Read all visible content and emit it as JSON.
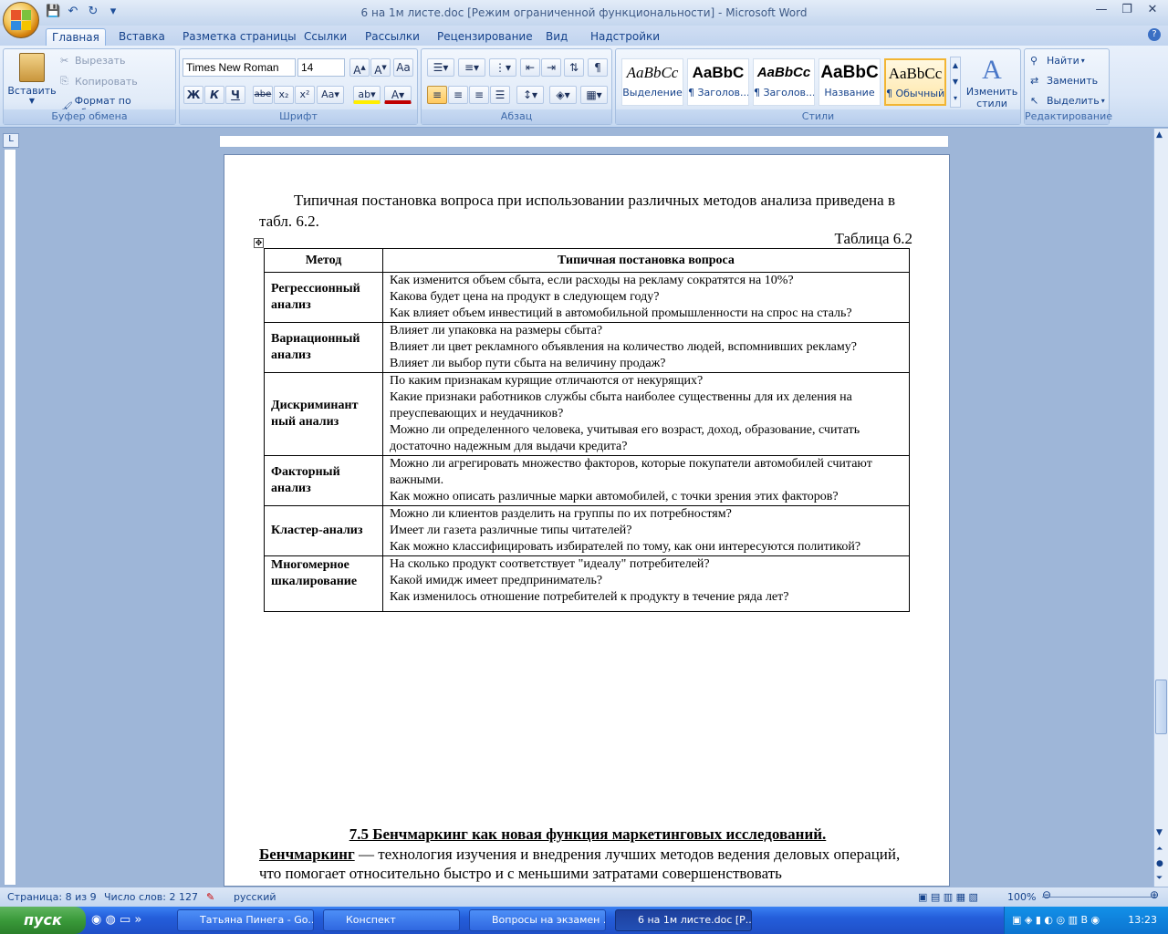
{
  "window": {
    "title": "6 на 1м листе.doc [Режим ограниченной функциональности] - Microsoft Word"
  },
  "tabs": [
    "Главная",
    "Вставка",
    "Разметка страницы",
    "Ссылки",
    "Рассылки",
    "Рецензирование",
    "Вид",
    "Надстройки"
  ],
  "ribbon": {
    "clipboard": {
      "label": "Буфер обмена",
      "paste": "Вставить",
      "cut": "Вырезать",
      "copy": "Копировать",
      "format_painter": "Формат по образцу"
    },
    "font": {
      "label": "Шрифт",
      "font_name": "Times New Roman",
      "font_size": "14"
    },
    "paragraph": {
      "label": "Абзац"
    },
    "styles": {
      "label": "Стили",
      "items": [
        {
          "preview": "AaBbCc",
          "name": "Выделение"
        },
        {
          "preview": "AaBbC",
          "name": "¶ Заголов..."
        },
        {
          "preview": "AaBbCc",
          "name": "¶ Заголов..."
        },
        {
          "preview": "AaBbC",
          "name": "Название"
        },
        {
          "preview": "AaBbCc",
          "name": "¶ Обычный"
        }
      ],
      "change": "Изменить стили"
    },
    "editing": {
      "label": "Редактирование",
      "find": "Найти",
      "replace": "Заменить",
      "select": "Выделить"
    }
  },
  "document": {
    "intro": "Типичная постановка вопроса при использовании различных методов анализа приведена в табл. 6.2.",
    "table_caption": "Таблица 6.2",
    "table": {
      "headers": [
        "Метод",
        "Типичная постановка вопроса"
      ],
      "rows": [
        {
          "method": "Регрессионный анализ",
          "questions": [
            "Как изменится объем сбыта, если расходы на рекламу сократятся на 10%?",
            "Какова будет цена на продукт в следующем году?",
            "Как влияет объем инвестиций в автомобильной промышленности на спрос на сталь?"
          ]
        },
        {
          "method": "Вариационный анализ",
          "questions": [
            "Влияет ли упаковка на размеры сбыта?",
            "Влияет ли цвет рекламного объявления на количество людей, вспомнивших рекламу?",
            "Влияет ли выбор пути сбыта на величину продаж?"
          ]
        },
        {
          "method": "Дискриминант ный анализ",
          "questions": [
            "По каким признакам курящие отличаются от некурящих?",
            "Какие признаки работников службы сбыта наиболее существенны для их деления на преуспевающих и неудачников?",
            "Можно ли определенного человека, учитывая его возраст, доход, образование, считать достаточно надежным для выдачи кредита?"
          ]
        },
        {
          "method": "Факторный анализ",
          "questions": [
            "Можно ли агрегировать множество факторов, которые покупатели автомобилей считают важными.",
            "Как можно описать различные марки автомобилей, с точки зрения этих факторов?"
          ]
        },
        {
          "method": "Кластер-анализ",
          "questions": [
            "Можно ли клиентов разделить на группы по их потребностям?",
            "Имеет ли газета различные типы читателей?",
            "Как можно классифицировать избирателей по тому, как они интересуются политикой?"
          ]
        },
        {
          "method": "Многомерное шкалирование",
          "questions": [
            "На сколько продукт соответствует \"идеалу\" потребителей?",
            "Какой имидж имеет предприниматель?",
            "Как изменилось отношение потребителей к продукту в течение ряда лет?"
          ]
        }
      ]
    },
    "section_heading": "7.5 Бенчмаркинг как новая функция маркетинговых исследований.",
    "term": "Бенчмаркинг",
    "definition": " — технология изучения и внедрения  лучших методов ведения деловых операций, что помогает относительно быстро и с меньшими затратами совершенствовать"
  },
  "statusbar": {
    "page": "Страница: 8 из 9",
    "words": "Число слов: 2 127",
    "language": "русский",
    "zoom": "100%"
  },
  "taskbar": {
    "start": "пуск",
    "items": [
      "Татьяна Пинега - Go...",
      "Конспект",
      "Вопросы на экзамен ...",
      "6 на 1м листе.doc [Р..."
    ],
    "clock": "13:23"
  },
  "colors": {
    "ribbon": "#dae6f7",
    "accent": "#15428b",
    "taskbar": "#245edb",
    "start": "#3a9a3a"
  }
}
